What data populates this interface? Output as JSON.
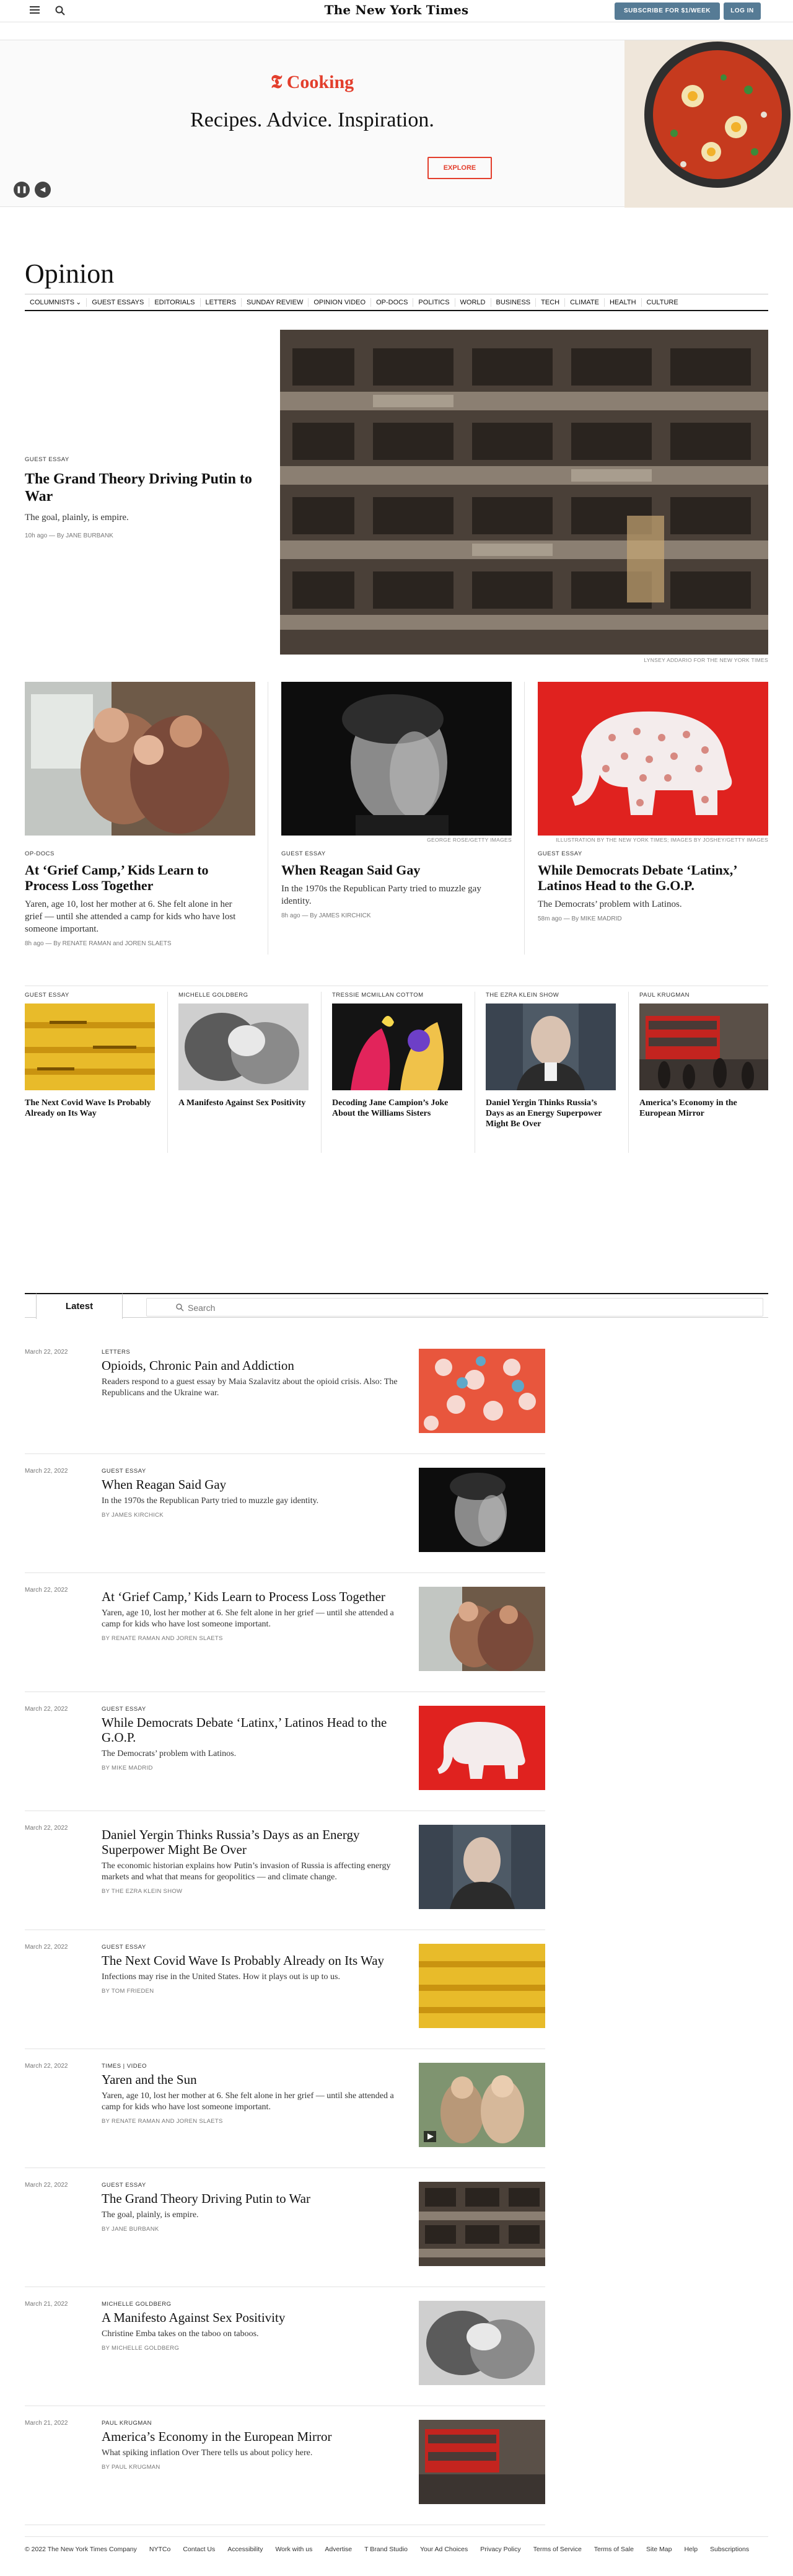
{
  "header": {
    "logo": "The New York Times",
    "subscribe_label": "SUBSCRIBE FOR $1/WEEK",
    "login_label": "LOG IN"
  },
  "ad": {
    "brand": "Cooking",
    "tagline": "Recipes. Advice. Inspiration.",
    "cta": "EXPLORE"
  },
  "section": {
    "title": "Opinion",
    "nav": [
      "COLUMNISTS",
      "GUEST ESSAYS",
      "EDITORIALS",
      "LETTERS",
      "SUNDAY REVIEW",
      "OPINION VIDEO",
      "OP-DOCS",
      "POLITICS",
      "WORLD",
      "BUSINESS",
      "TECH",
      "CLIMATE",
      "HEALTH",
      "CULTURE"
    ]
  },
  "lead": {
    "kicker": "GUEST ESSAY",
    "headline": "The Grand Theory Driving Putin to War",
    "summary": "The goal, plainly, is empire.",
    "byline": "10h ago — By JANE BURBANK",
    "credit": "LYNSEY ADDARIO FOR THE NEW YORK TIMES"
  },
  "secondary": [
    {
      "kicker": "OP-DOCS",
      "headline": "At ‘Grief Camp,’ Kids Learn to Process Loss Together",
      "summary": "Yaren, age 10, lost her mother at 6. She felt alone in her grief — until she attended a camp for kids who have lost someone important.",
      "byline": "8h ago — By RENATE RAMAN and JOREN SLAETS",
      "credit": ""
    },
    {
      "kicker": "GUEST ESSAY",
      "headline": "When Reagan Said Gay",
      "summary": "In the 1970s the Republican Party tried to muzzle gay identity.",
      "byline": "8h ago — By JAMES KIRCHICK",
      "credit": "GEORGE ROSE/GETTY IMAGES"
    },
    {
      "kicker": "GUEST ESSAY",
      "headline": "While Democrats Debate ‘Latinx,’ Latinos Head to the G.O.P.",
      "summary": "The Democrats’ problem with Latinos.",
      "byline": "58m ago — By MIKE MADRID",
      "credit": "ILLUSTRATION BY THE NEW YORK TIMES; IMAGES BY JOSHEY/GETTY IMAGES"
    }
  ],
  "columns": [
    {
      "kicker": "GUEST ESSAY",
      "headline": "The Next Covid Wave Is Probably Already on Its Way"
    },
    {
      "kicker": "MICHELLE GOLDBERG",
      "headline": "A Manifesto Against Sex Positivity"
    },
    {
      "kicker": "TRESSIE McMILLAN COTTOM",
      "headline": "Decoding Jane Campion’s Joke About the Williams Sisters"
    },
    {
      "kicker": "THE EZRA KLEIN SHOW",
      "headline": "Daniel Yergin Thinks Russia’s Days as an Energy Superpower Might Be Over"
    },
    {
      "kicker": "PAUL KRUGMAN",
      "headline": "America’s Economy in the European Mirror"
    }
  ],
  "latest": {
    "tab_label": "Latest",
    "search_placeholder": "Search",
    "items": [
      {
        "date": "March 22, 2022",
        "kicker": "LETTERS",
        "headline": "Opioids, Chronic Pain and Addiction",
        "summary": "Readers respond to a guest essay by Maia Szalavitz about the opioid crisis. Also: The Republicans and the Ukraine war.",
        "byline": ""
      },
      {
        "date": "March 22, 2022",
        "kicker": "GUEST ESSAY",
        "headline": "When Reagan Said Gay",
        "summary": "In the 1970s the Republican Party tried to muzzle gay identity.",
        "byline": "By JAMES KIRCHICK"
      },
      {
        "date": "March 22, 2022",
        "kicker": "",
        "headline": "At ‘Grief Camp,’ Kids Learn to Process Loss Together",
        "summary": "Yaren, age 10, lost her mother at 6. She felt alone in her grief — until she attended a camp for kids who have lost someone important.",
        "byline": "By RENATE RAMAN and JOREN SLAETS"
      },
      {
        "date": "March 22, 2022",
        "kicker": "GUEST ESSAY",
        "headline": "While Democrats Debate ‘Latinx,’ Latinos Head to the G.O.P.",
        "summary": "The Democrats’ problem with Latinos.",
        "byline": "By MIKE MADRID"
      },
      {
        "date": "March 22, 2022",
        "kicker": "",
        "headline": "Daniel Yergin Thinks Russia’s Days as an Energy Superpower Might Be Over",
        "summary": "The economic historian explains how Putin’s invasion of Russia is affecting energy markets and what that means for geopolitics — and climate change.",
        "byline": "By THE EZRA KLEIN SHOW"
      },
      {
        "date": "March 22, 2022",
        "kicker": "GUEST ESSAY",
        "headline": "The Next Covid Wave Is Probably Already on Its Way",
        "summary": "Infections may rise in the United States. How it plays out is up to us.",
        "byline": "By TOM FRIEDEN"
      },
      {
        "date": "March 22, 2022",
        "kicker": "Times  |  VIDEO",
        "headline": "Yaren and the Sun",
        "summary": "Yaren, age 10, lost her mother at 6. She felt alone in her grief — until she attended a camp for kids who have lost someone important.",
        "byline": "By RENATE RAMAN and JOREN SLAETS"
      },
      {
        "date": "March 22, 2022",
        "kicker": "GUEST ESSAY",
        "headline": "The Grand Theory Driving Putin to War",
        "summary": "The goal, plainly, is empire.",
        "byline": "By JANE BURBANK"
      },
      {
        "date": "March 21, 2022",
        "kicker": "MICHELLE GOLDBERG",
        "headline": "A Manifesto Against Sex Positivity",
        "summary": "Christine Emba takes on the taboo on taboos.",
        "byline": "By MICHELLE GOLDBERG"
      },
      {
        "date": "March 21, 2022",
        "kicker": "PAUL KRUGMAN",
        "headline": "America’s Economy in the European Mirror",
        "summary": "What spiking inflation Over There tells us about policy here.",
        "byline": "By PAUL KRUGMAN"
      }
    ]
  },
  "footer": [
    "© 2022 The New York Times Company",
    "NYTCo",
    "Contact Us",
    "Accessibility",
    "Work with us",
    "Advertise",
    "T Brand Studio",
    "Your Ad Choices",
    "Privacy Policy",
    "Terms of Service",
    "Terms of Sale",
    "Site Map",
    "Help",
    "Subscriptions"
  ]
}
